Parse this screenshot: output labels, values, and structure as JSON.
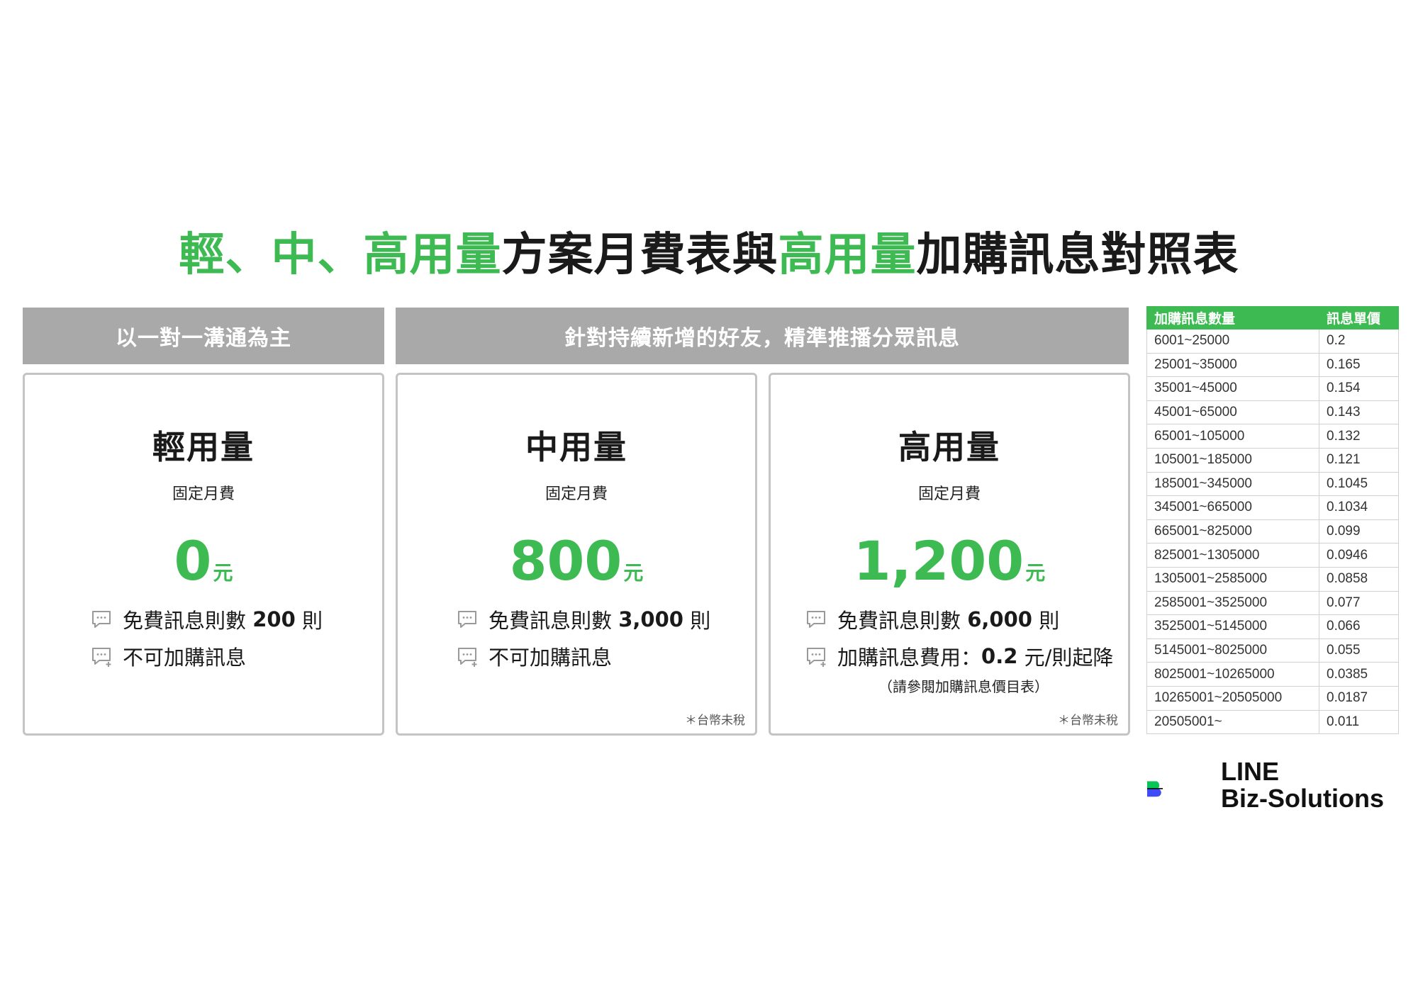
{
  "title": {
    "part1_green": "輕、中、高用量",
    "part2": "方案月費表與",
    "part3_green": "高用量",
    "part4": "加購訊息對照表"
  },
  "group_headers": {
    "left": "以一對一溝通為主",
    "right": "針對持續新增的好友，精準推播分眾訊息"
  },
  "plans": [
    {
      "name": "輕用量",
      "fee_label": "固定月費",
      "price": "0",
      "unit": "元",
      "free_prefix": "免費訊息則數",
      "free_count": "200",
      "free_suffix": "則",
      "addon_text": "不可加購訊息",
      "addon_value": "",
      "addon_suffix": "",
      "addon_note": "",
      "tax_note": ""
    },
    {
      "name": "中用量",
      "fee_label": "固定月費",
      "price": "800",
      "unit": "元",
      "free_prefix": "免費訊息則數",
      "free_count": "3,000",
      "free_suffix": "則",
      "addon_text": "不可加購訊息",
      "addon_value": "",
      "addon_suffix": "",
      "addon_note": "",
      "tax_note": "＊台幣未稅"
    },
    {
      "name": "高用量",
      "fee_label": "固定月費",
      "price": "1,200",
      "unit": "元",
      "free_prefix": "免費訊息則數",
      "free_count": "6,000",
      "free_suffix": "則",
      "addon_text": "加購訊息費用：",
      "addon_value": "0.2",
      "addon_suffix": "元/則起降",
      "addon_note": "（請參閱加購訊息價目表）",
      "tax_note": "＊台幣未稅"
    }
  ],
  "rate_table": {
    "headers": [
      "加購訊息數量",
      "訊息單價"
    ],
    "rows": [
      [
        "6001~25000",
        "0.2"
      ],
      [
        "25001~35000",
        "0.165"
      ],
      [
        "35001~45000",
        "0.154"
      ],
      [
        "45001~65000",
        "0.143"
      ],
      [
        "65001~105000",
        "0.132"
      ],
      [
        "105001~185000",
        "0.121"
      ],
      [
        "185001~345000",
        "0.1045"
      ],
      [
        "345001~665000",
        "0.1034"
      ],
      [
        "665001~825000",
        "0.099"
      ],
      [
        "825001~1305000",
        "0.0946"
      ],
      [
        "1305001~2585000",
        "0.0858"
      ],
      [
        "2585001~3525000",
        "0.077"
      ],
      [
        "3525001~5145000",
        "0.066"
      ],
      [
        "5145001~8025000",
        "0.055"
      ],
      [
        "8025001~10265000",
        "0.0385"
      ],
      [
        "10265001~20505000",
        "0.0187"
      ],
      [
        "20505001~",
        "0.011"
      ]
    ]
  },
  "logo": {
    "line1": "LINE",
    "line2": "Biz-Solutions",
    "colors": {
      "green": "#06c755",
      "black": "#111111",
      "blue": "#3d4cf5"
    }
  },
  "colors": {
    "accent_green": "#3dba52",
    "header_gray": "#a9a9a9"
  },
  "icons": {
    "message": "chat-bubble-icon",
    "add_message": "chat-bubble-plus-icon"
  }
}
